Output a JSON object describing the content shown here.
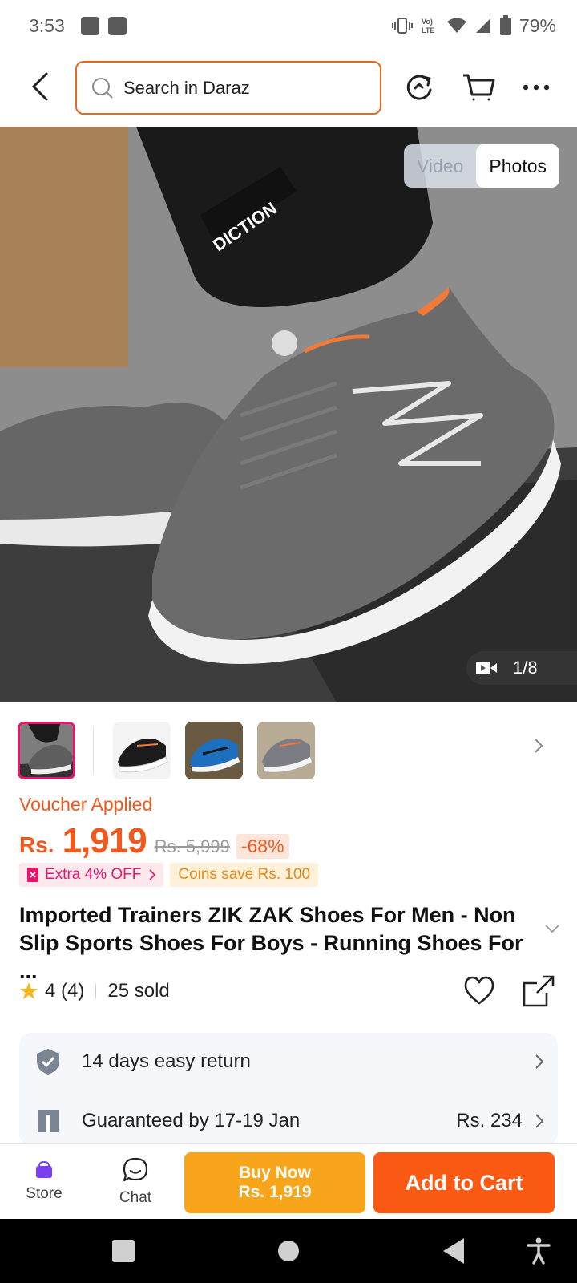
{
  "status_bar": {
    "time": "3:53",
    "battery": "79%"
  },
  "top_nav": {
    "search_placeholder": "Search in Daraz"
  },
  "media": {
    "video_label": "Video",
    "photos_label": "Photos",
    "counter": "1/8"
  },
  "thumbnails": [
    {
      "name": "thumb-gray-worn",
      "color": "#6e6e6e"
    },
    {
      "name": "thumb-black",
      "color": "#1c1c1c"
    },
    {
      "name": "thumb-blue",
      "color": "#1f6fbf"
    },
    {
      "name": "thumb-gray",
      "color": "#7c7c84"
    }
  ],
  "price": {
    "voucher_label": "Voucher Applied",
    "currency": "Rs.",
    "amount": "1,919",
    "original": "Rs. 5,999",
    "discount": "-68%"
  },
  "promos": {
    "extra": "Extra 4% OFF",
    "coins": "Coins save Rs. 100"
  },
  "product": {
    "title": "Imported Trainers ZIK ZAK Shoes For Men - Non Slip Sports Shoes For Boys - Running Shoes For ...",
    "rating": "4 (4)",
    "sold": "25 sold"
  },
  "services": {
    "returns": "14 days easy return",
    "delivery": "Guaranteed by 17-19 Jan",
    "delivery_fee": "Rs. 234"
  },
  "bottom_bar": {
    "store_label": "Store",
    "chat_label": "Chat",
    "buy_now_label": "Buy Now",
    "buy_now_price": "Rs. 1,919",
    "add_to_cart_label": "Add to Cart"
  },
  "colors": {
    "accent": "#f1581d",
    "buy_now": "#f9a51b",
    "add_to_cart": "#fa5a14",
    "voucher_pink": "#e6166f"
  }
}
